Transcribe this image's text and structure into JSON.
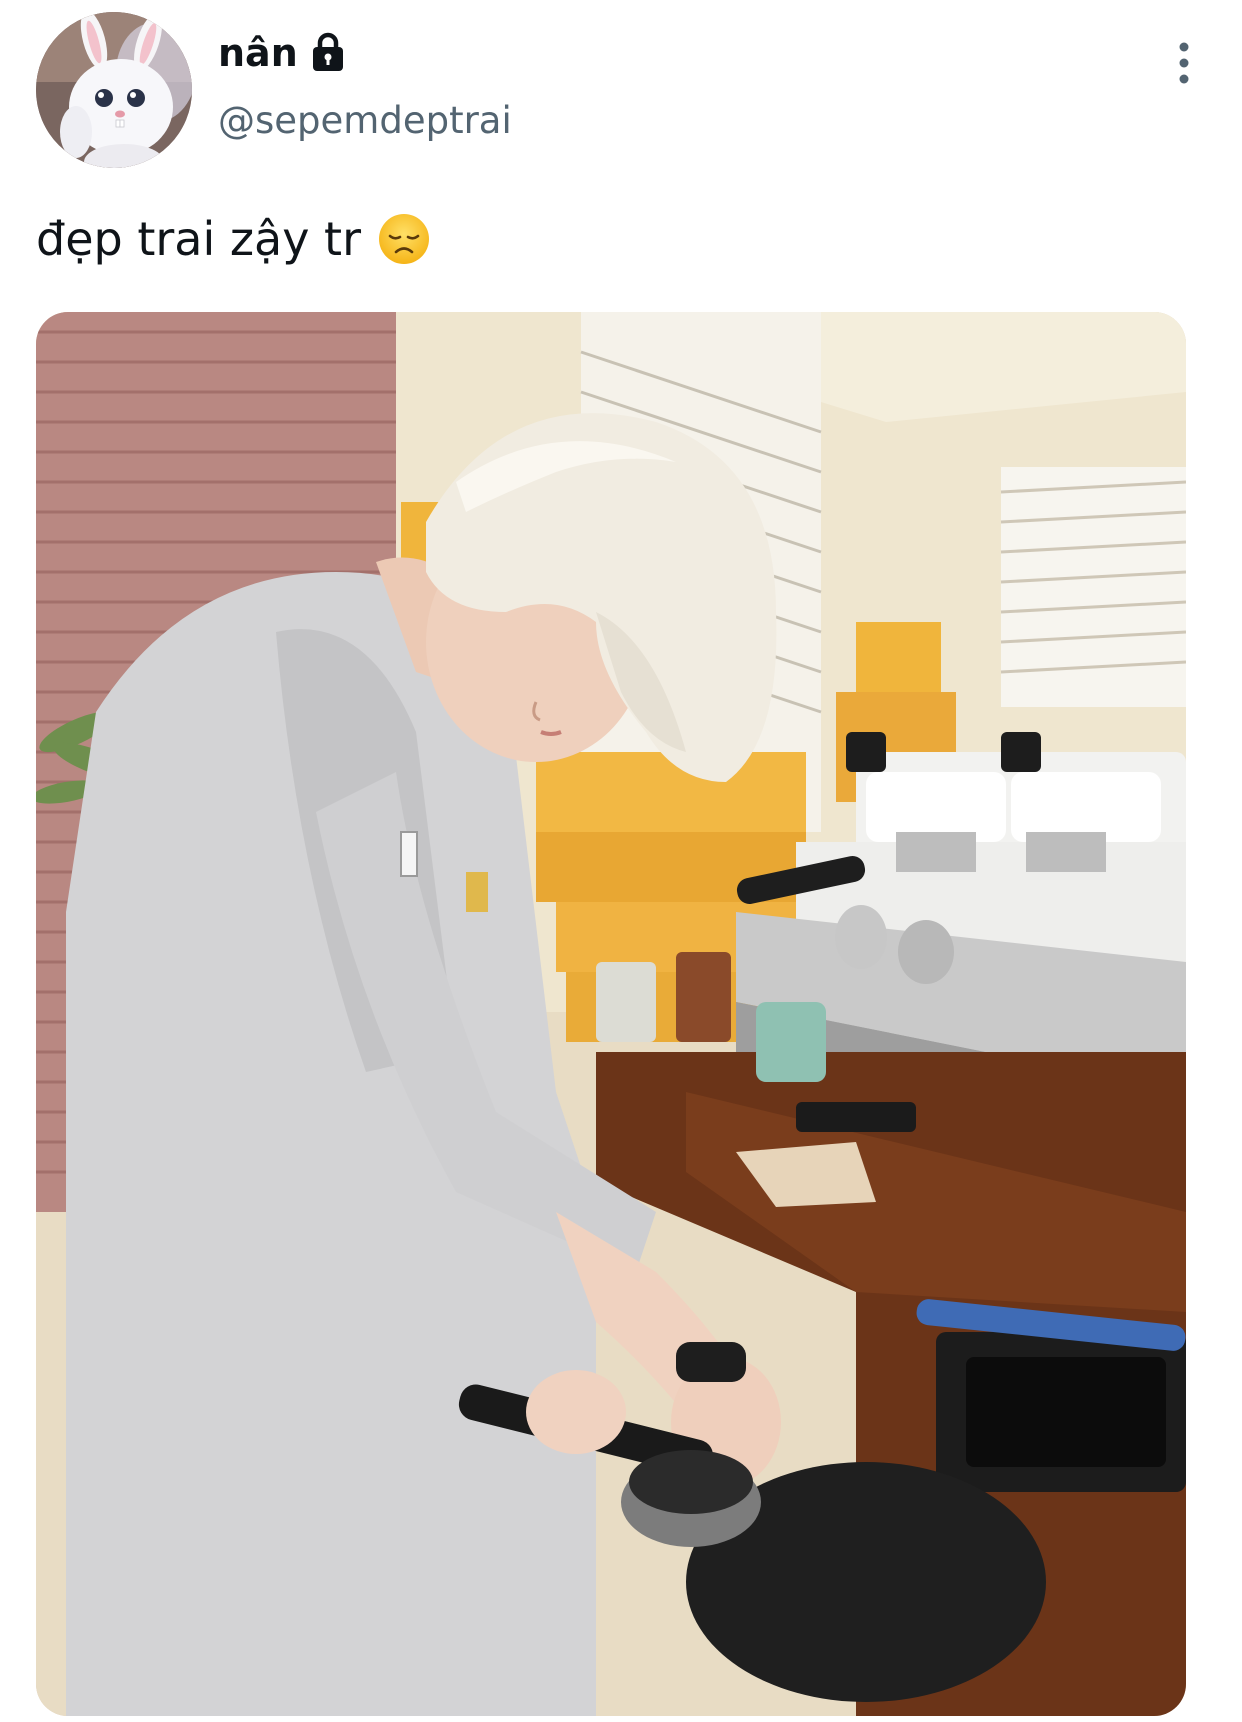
{
  "author": {
    "display_name": "nân",
    "handle": "@sepemdeptrai",
    "protected_icon": "lock-icon",
    "avatar_icon": "white-bunny-avatar"
  },
  "menu": {
    "icon": "more-vertical-icon"
  },
  "tweet": {
    "text": "đẹp trai zậy tr",
    "emoji": "disappointed-face-emoji"
  },
  "media": {
    "kind": "photo",
    "subject": "blond barista tamping espresso at a coffee machine"
  },
  "colors": {
    "text_primary": "#0f1419",
    "text_secondary": "#536471",
    "background": "#ffffff"
  }
}
